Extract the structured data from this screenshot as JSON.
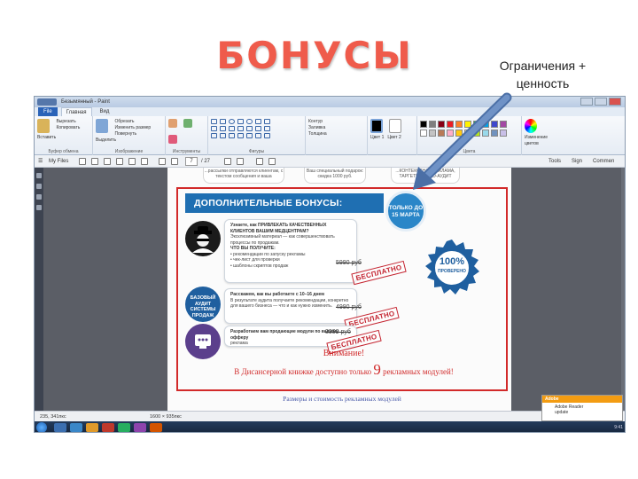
{
  "slide": {
    "title": "БОНУСЫ",
    "callout_line1": "Ограничения +",
    "callout_line2": "ценность"
  },
  "window": {
    "title": "Безымянный - Paint",
    "file_tab": "File",
    "tabs": [
      "Главная",
      "Вид"
    ],
    "ribbon": {
      "clipboard_label": "Буфер обмена",
      "paste_label": "Вставить",
      "cut_label": "Вырезать",
      "copy_label": "Копировать",
      "image_label": "Изображение",
      "select_label": "Выделить",
      "crop_label": "Обрезать",
      "resize_label": "Изменить размер",
      "rotate_label": "Повернуть",
      "tools_label": "Инструменты",
      "shapes_label": "Фигуры",
      "outline_label": "Контур",
      "fill_label": "Заливка",
      "size_label": "Толщина",
      "color1_label": "Цвет 1",
      "color2_label": "Цвет 2",
      "colors_label": "Цвета",
      "edit_colors_label": "Изменение цветов"
    },
    "swatch_colors": [
      "#000000",
      "#7f7f7f",
      "#880015",
      "#ed1c24",
      "#ff7f27",
      "#fff200",
      "#22b14c",
      "#00a2e8",
      "#3f48cc",
      "#a349a4",
      "#ffffff",
      "#c3c3c3",
      "#b97a57",
      "#ffaec9",
      "#ffc90e",
      "#efe4b0",
      "#b5e61d",
      "#99d9ea",
      "#7092be",
      "#c8bfe7"
    ],
    "reader_toolbar": {
      "myfiles_label": "My Files",
      "page_current": "7",
      "page_total": "/ 27",
      "tools_label": "Tools",
      "sign_label": "Sign",
      "comment_label": "Commen"
    },
    "statusbar": {
      "position": "235, 341пкс",
      "dimensions": "1600 × 935пкс"
    },
    "notification": {
      "header": "Adobe",
      "line1": "Adobe Reader",
      "line2": "update"
    },
    "tray_time": "9:41"
  },
  "document": {
    "top_boxes": [
      "...рассылки отправляются клиентам, с текстом сообщения и ваша",
      "Ваш специальный подарок: скидка 1000 руб.",
      "...КОНТЕКСТНАЯ РЕКЛАМА, ТАРГЕТИНГ, SEO-АУДИТ"
    ],
    "banner": "ДОПОЛНИТЕЛЬНЫЕ БОНУСЫ:",
    "badge_line1": "ТОЛЬКО ДО",
    "badge_line2": "15 МАРТА",
    "items": [
      {
        "lead": "Узнаете, как ПРИВЛЕКАТЬ КАЧЕСТВЕННЫХ КЛИЕНТОВ ВАШИМ МЕДЦЕНТРАМ?",
        "sub": "Эксклюзивный материал — как совершенствовать процессы по продажам.",
        "points_title": "ЧТО ВЫ ПОЛУЧИТЕ:",
        "point1": "• рекомендации по запуску рекламы",
        "point2": "• чек-лист для проверки",
        "point3": "• шаблоны скриптов продаж",
        "price": "5990 руб",
        "stamp": "БЕСПЛАТНО"
      },
      {
        "icon_text": "БАЗОВЫЙ АУДИТ СИСТЕМЫ ПРОДАЖ",
        "lead": "Расскажем, как вы работаете с 10–16 днем",
        "sub": "В результате аудита получаете рекомендации, конкретно для вашего бизнеса — что и как нужно изменить.",
        "price": "4990 руб",
        "stamp": "БЕСПЛАТНО"
      },
      {
        "lead": "Разработаем вам продающие модули по вашему офферу",
        "sub": "реклама",
        "price": "3990 руб",
        "stamp": "БЕСПЛАТНО"
      }
    ],
    "seal_text": "100%",
    "seal_sub": "ПРОВЕРЕНО",
    "attention_title": "Внимание!",
    "attention_pre": "В Дисансерной книжке доступно только",
    "attention_num": "9",
    "attention_post": "рекламных модулей!",
    "sizes_link": "Размеры и стоимость рекламных модулей"
  }
}
